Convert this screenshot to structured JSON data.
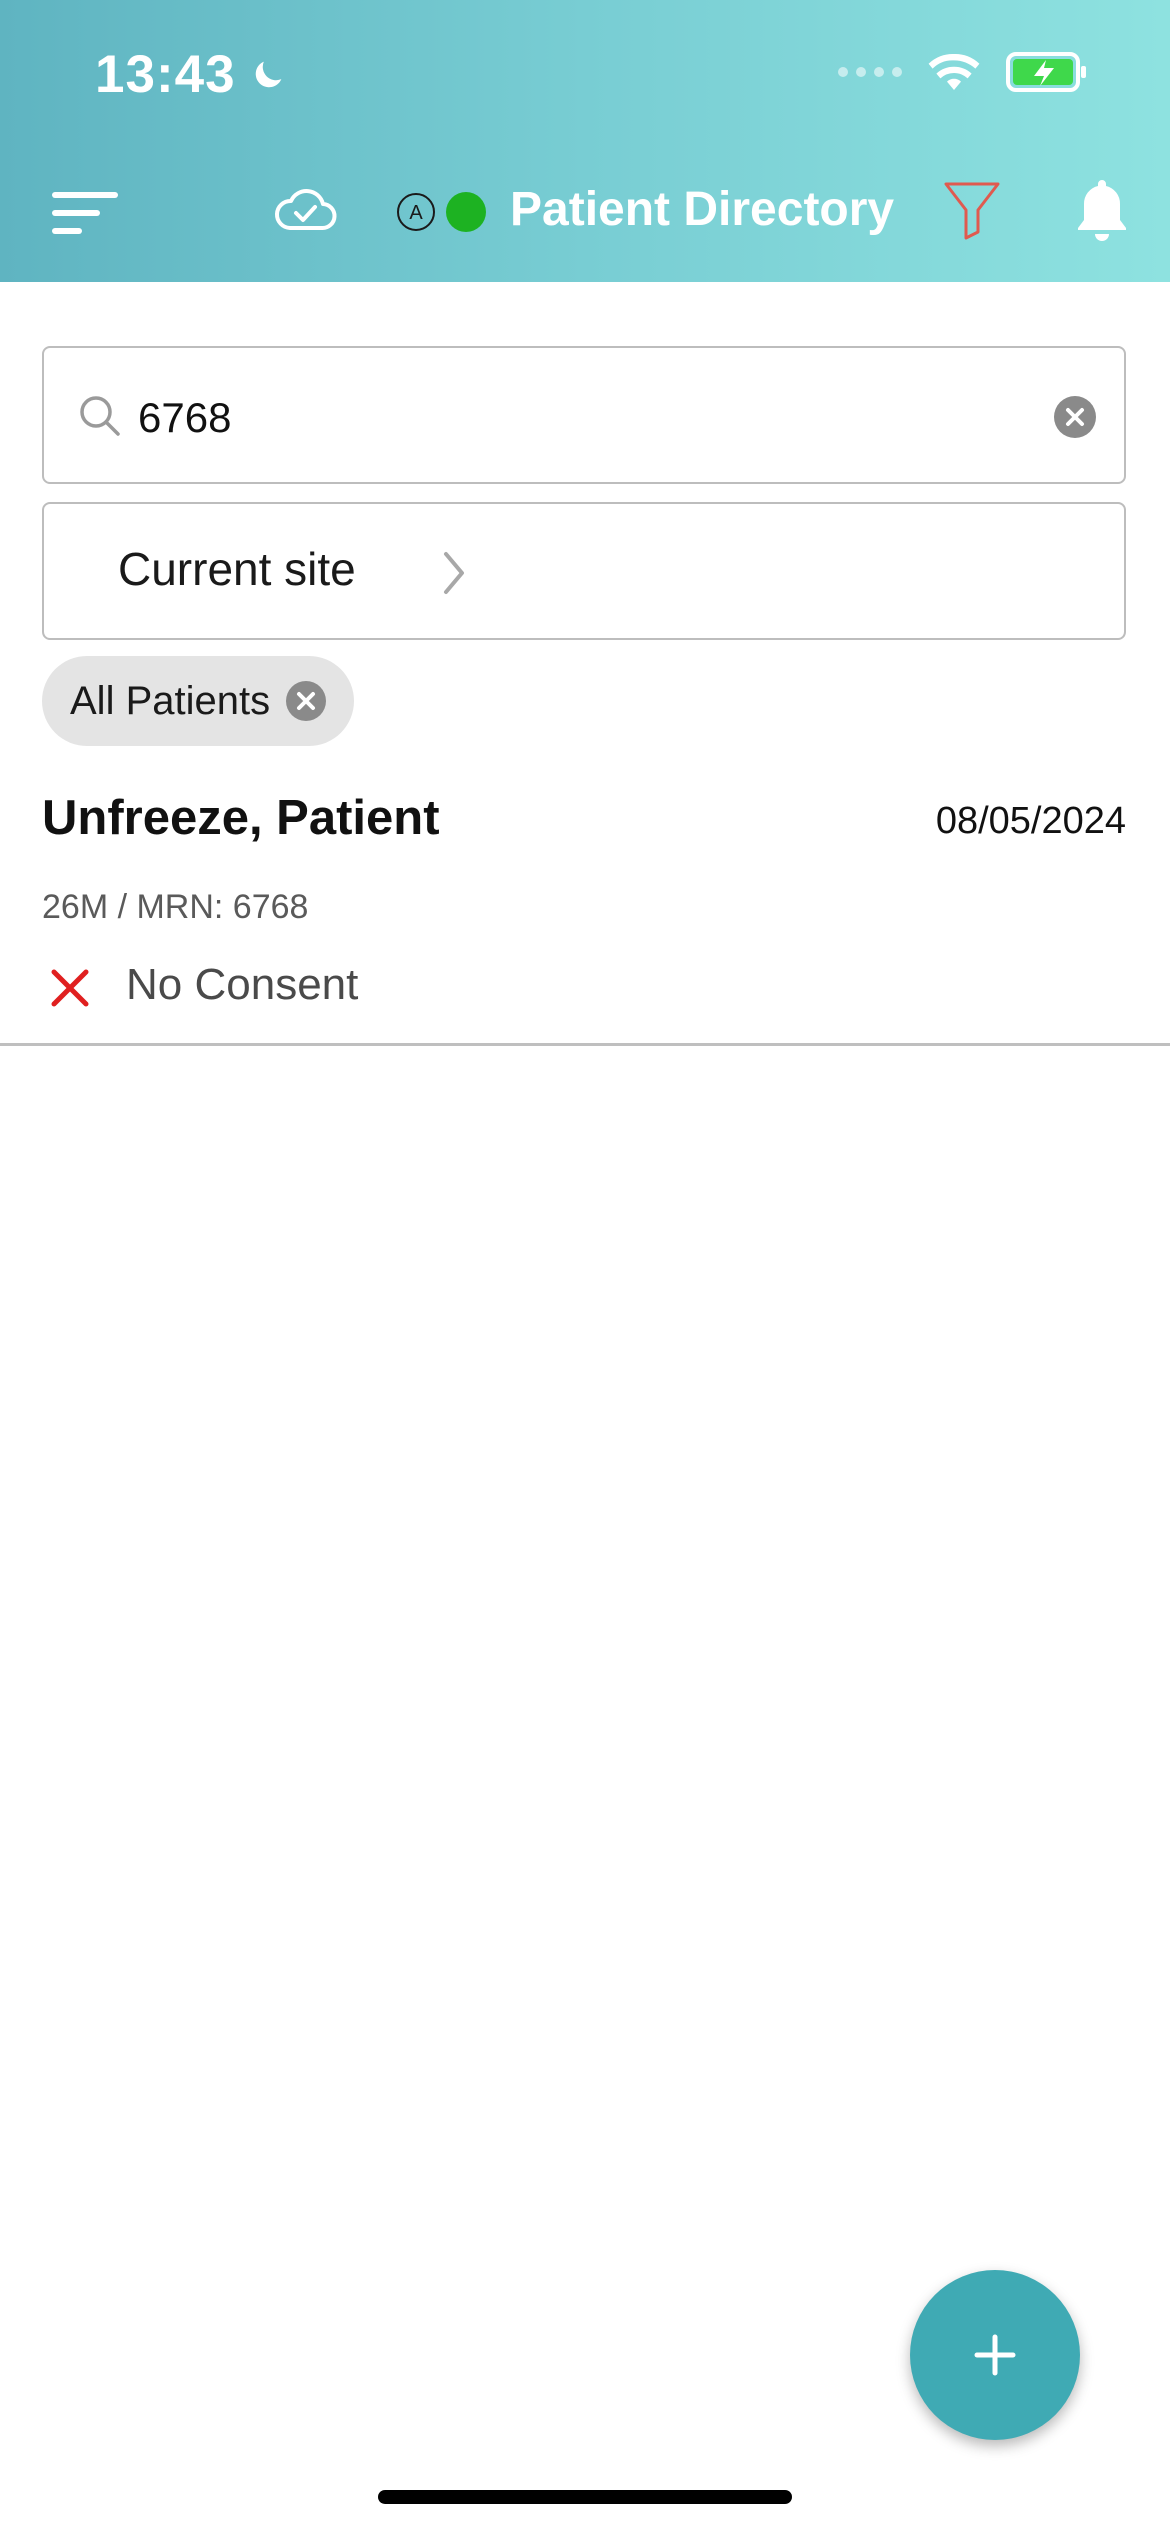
{
  "status_bar": {
    "time": "13:43",
    "moon_icon": "moon-icon",
    "wifi_icon": "wifi-icon",
    "battery_icon": "battery-charging-icon"
  },
  "header": {
    "title": "Patient Directory",
    "mode_badge": "A",
    "online_status_color": "#1db222",
    "gradient_start": "#5fb4c1",
    "gradient_end": "#8ee2e0",
    "filter_icon_color": "#e05a4f"
  },
  "search": {
    "value": "6768",
    "placeholder": ""
  },
  "site_selector": {
    "label": "Current site"
  },
  "filter_chip": {
    "label": "All Patients"
  },
  "patients": [
    {
      "name": "Unfreeze, Patient",
      "date": "08/05/2024",
      "meta": "26M / MRN: 6768",
      "consent": "No Consent",
      "consent_color": "#e02020"
    }
  ],
  "fab": {
    "icon": "plus-icon",
    "color": "#3faab4"
  }
}
